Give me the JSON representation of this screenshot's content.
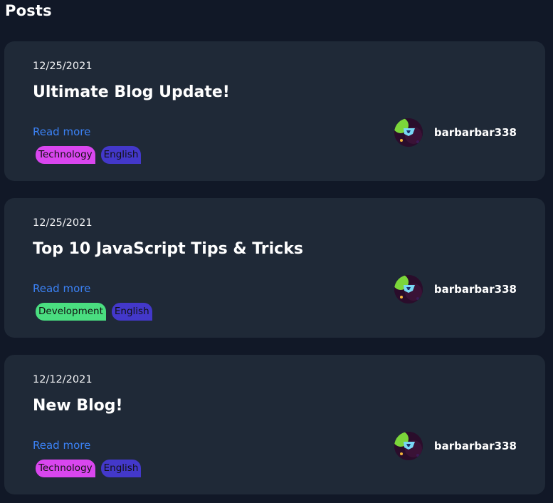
{
  "page": {
    "title": "Posts"
  },
  "posts": [
    {
      "date": "12/25/2021",
      "title": "Ultimate Blog Update!",
      "read_more": "Read more",
      "author": "barbarbar338",
      "tags": [
        {
          "label": "Technology",
          "color": "#d946ef"
        },
        {
          "label": "English",
          "color": "#4338ca"
        }
      ]
    },
    {
      "date": "12/25/2021",
      "title": "Top 10 JavaScript Tips & Tricks",
      "read_more": "Read more",
      "author": "barbarbar338",
      "tags": [
        {
          "label": "Development",
          "color": "#4ade80"
        },
        {
          "label": "English",
          "color": "#4338ca"
        }
      ]
    },
    {
      "date": "12/12/2021",
      "title": "New Blog!",
      "read_more": "Read more",
      "author": "barbarbar338",
      "tags": [
        {
          "label": "Technology",
          "color": "#d946ef"
        },
        {
          "label": "English",
          "color": "#4338ca"
        }
      ]
    }
  ],
  "theme": {
    "background": "#111827",
    "card": "#1f2937",
    "link": "#3b82f6"
  }
}
